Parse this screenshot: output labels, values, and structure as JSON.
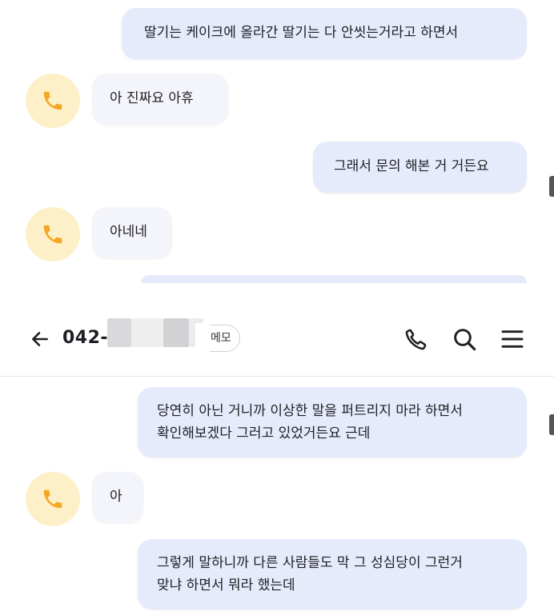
{
  "header": {
    "phone_number_partial": "042-",
    "memo_label": "메모"
  },
  "chat_top": [
    {
      "side": "out",
      "text": "딸기는 케이크에 올라간 딸기는 다 안씻는거라고 하면서"
    },
    {
      "side": "in",
      "text": "아 진짜요 아휴"
    },
    {
      "side": "out",
      "text": "그래서 문의 해본 거 거든요"
    },
    {
      "side": "in",
      "text": "아네네"
    }
  ],
  "chat_bottom": [
    {
      "side": "out",
      "line1": "당연히 아닌 거니까 이상한 말을 퍼트리지 마라 하면서",
      "line2": "확인해보겠다 그러고 있었거든요 근데"
    },
    {
      "side": "in",
      "text": "아"
    },
    {
      "side": "out",
      "line1": "그렇게 말하니까 다른 사람들도 막 그 성심당이 그런거",
      "line2": "맞냐 하면서 뭐라 했는데"
    }
  ],
  "icons": {
    "avatar_icon": "phone-icon",
    "back": "arrow-left-icon",
    "call": "phone-icon",
    "search": "search-icon",
    "menu": "hamburger-menu-icon"
  },
  "colors": {
    "outgoing_bubble": "#e6ebfb",
    "incoming_bubble": "#f4f5fa",
    "avatar_bg": "#fdf0c9",
    "avatar_icon": "#f5a623"
  }
}
